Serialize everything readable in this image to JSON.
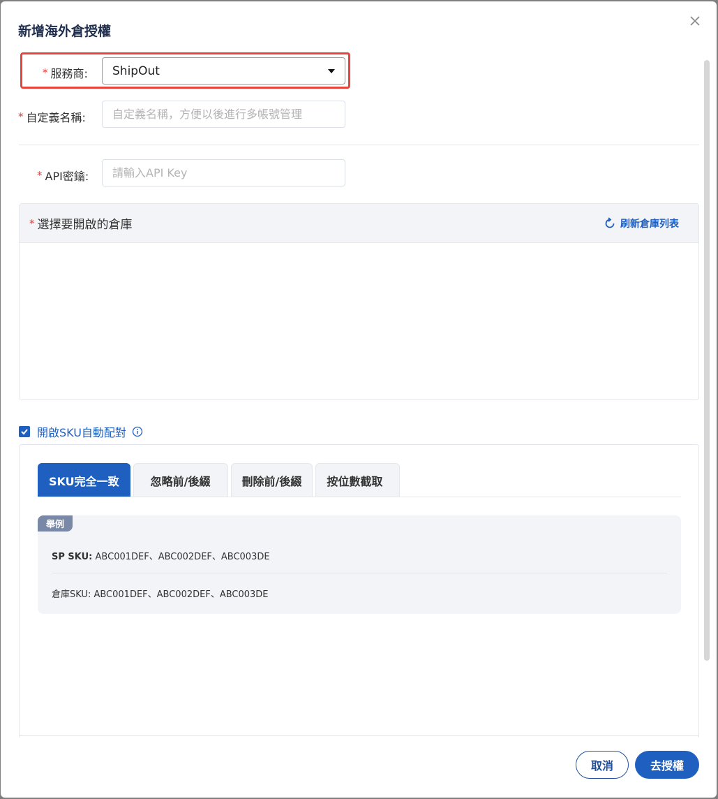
{
  "dialog": {
    "title": "新增海外倉授權",
    "close_icon": "close-icon"
  },
  "form": {
    "provider": {
      "required_mark": "*",
      "label": "服務商:",
      "value": "ShipOut"
    },
    "custom_name": {
      "required_mark": "*",
      "label": "自定義名稱:",
      "placeholder": "自定義名稱，方便以後進行多帳號管理",
      "value": ""
    },
    "api_key": {
      "required_mark": "*",
      "label": "API密鑰:",
      "placeholder": "請輸入API Key",
      "value": ""
    }
  },
  "warehouse": {
    "required_mark": "*",
    "title": "選擇要開啟的倉庫",
    "refresh_label": "刷新倉庫列表",
    "refresh_icon": "refresh-icon"
  },
  "sku_auto_match": {
    "checked": true,
    "label": "開啟SKU自動配對",
    "info_icon": "info-icon",
    "tabs": [
      {
        "label": "SKU完全一致",
        "active": true
      },
      {
        "label": "忽略前/後綴",
        "active": false
      },
      {
        "label": "刪除前/後綴",
        "active": false
      },
      {
        "label": "按位數截取",
        "active": false
      }
    ],
    "example": {
      "badge": "舉例",
      "sp_sku_label": "SP SKU:",
      "sp_sku_value": "ABC001DEF、ABC002DEF、ABC003DE",
      "wh_sku_label": "倉庫SKU:",
      "wh_sku_value": "ABC001DEF、ABC002DEF、ABC003DE"
    }
  },
  "footer": {
    "cancel_label": "取消",
    "confirm_label": "去授權"
  },
  "colors": {
    "primary": "#1f5fbf",
    "required": "#e23c3c",
    "highlight_border": "#e5453b"
  }
}
